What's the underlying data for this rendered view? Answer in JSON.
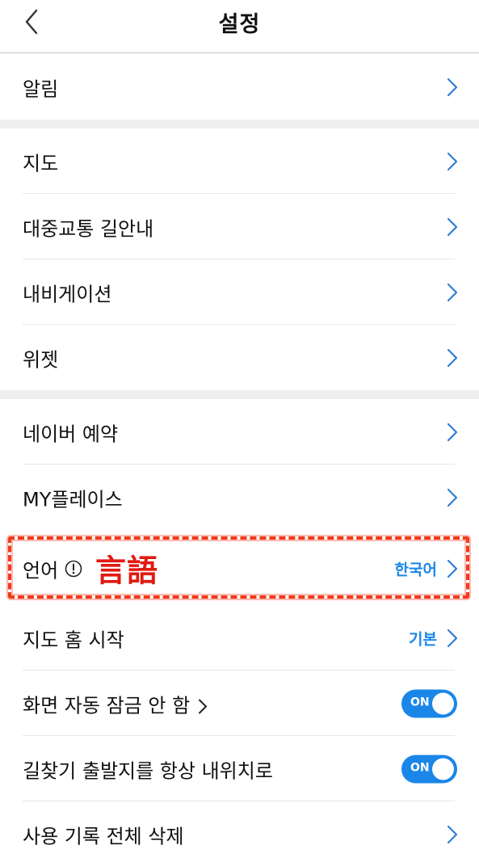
{
  "header": {
    "title": "설정",
    "back_icon": "chevron-left-icon"
  },
  "rows": {
    "alerts": {
      "label": "알림"
    },
    "map": {
      "label": "지도"
    },
    "transit": {
      "label": "대중교통 길안내"
    },
    "navigation": {
      "label": "내비게이션"
    },
    "widget": {
      "label": "위젯"
    },
    "reservation": {
      "label": "네이버 예약"
    },
    "myplace": {
      "label": "MY플레이스"
    },
    "language": {
      "label": "언어",
      "annotation": "言語",
      "value": "한국어"
    },
    "map_home": {
      "label": "지도 홈 시작",
      "value": "기본"
    },
    "screen_lock": {
      "label": "화면 자동 잠금 안 함",
      "toggle": "ON"
    },
    "route_start": {
      "label": "길찾기 출발지를 항상 내위치로",
      "toggle": "ON"
    },
    "delete_history": {
      "label": "사용 기록 전체 삭제"
    }
  },
  "colors": {
    "accent": "#1a86e8",
    "chevron": "#2f7fd6",
    "highlight": "#f23a1c",
    "separator": "#eeeeee"
  }
}
